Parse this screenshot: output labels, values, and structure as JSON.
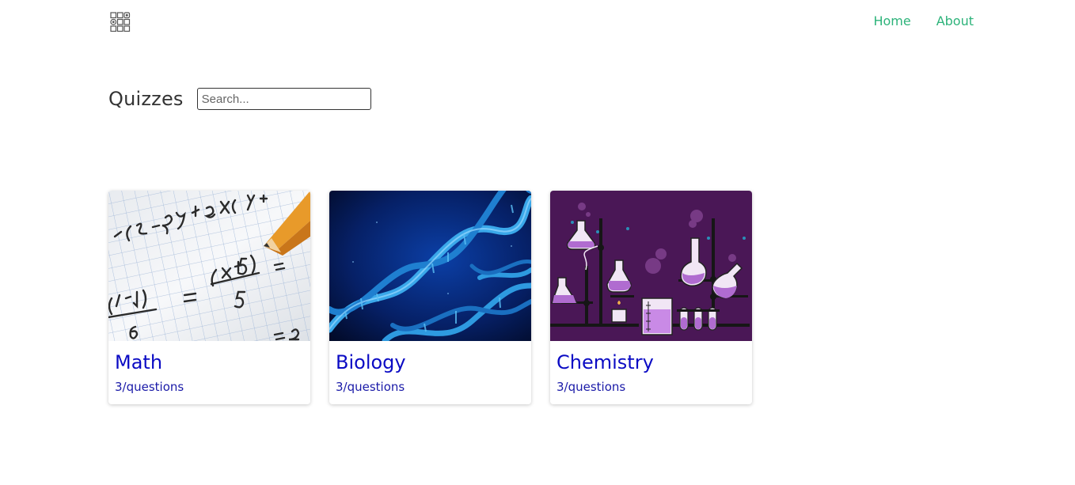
{
  "nav": {
    "logo_icon": "grid-logo-icon",
    "links": [
      {
        "label": "Home"
      },
      {
        "label": "About"
      }
    ],
    "link_color": "#2db37a"
  },
  "main": {
    "title": "Quizzes",
    "search": {
      "placeholder": "Search...",
      "value": ""
    },
    "cards": [
      {
        "title": "Math",
        "subtitle": "3/questions",
        "image": "math-equations-image"
      },
      {
        "title": "Biology",
        "subtitle": "3/questions",
        "image": "dna-helix-image"
      },
      {
        "title": "Chemistry",
        "subtitle": "3/questions",
        "image": "chemistry-lab-image"
      }
    ],
    "card_title_color": "#0b0bc4"
  }
}
